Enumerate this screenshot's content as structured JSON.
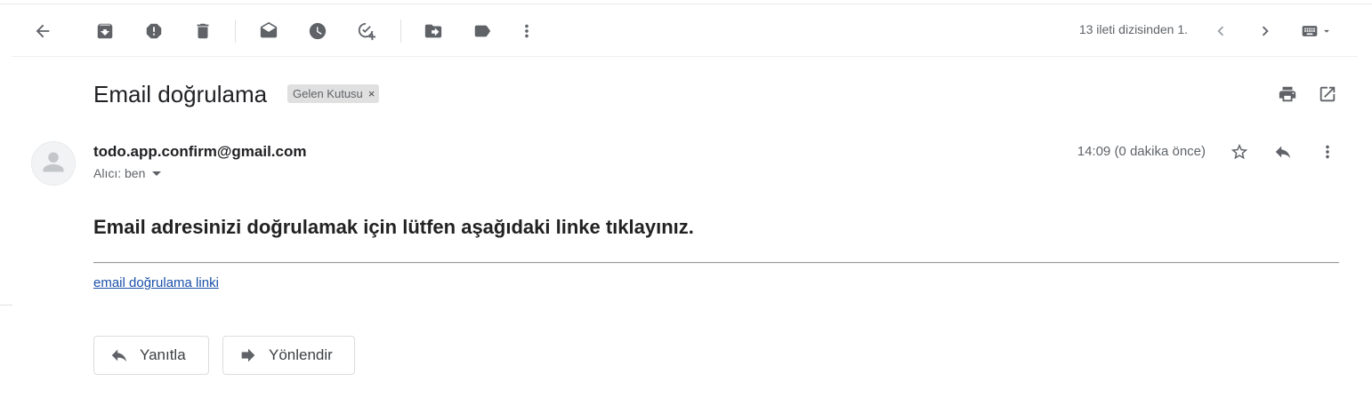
{
  "toolbar": {
    "pager_text": "13 ileti dizisinden 1."
  },
  "message": {
    "subject": "Email doğrulama",
    "label": "Gelen Kutusu",
    "label_remove": "×",
    "sender": "todo.app.confirm@gmail.com",
    "recipient": "Alıcı: ben",
    "timestamp": "14:09 (0 dakika önce)"
  },
  "body": {
    "heading": "Email adresinizi doğrulamak için lütfen aşağıdaki linke tıklayınız.",
    "link_text": "email doğrulama linki"
  },
  "actions": {
    "reply_label": "Yanıtla",
    "forward_label": "Yönlendir"
  }
}
